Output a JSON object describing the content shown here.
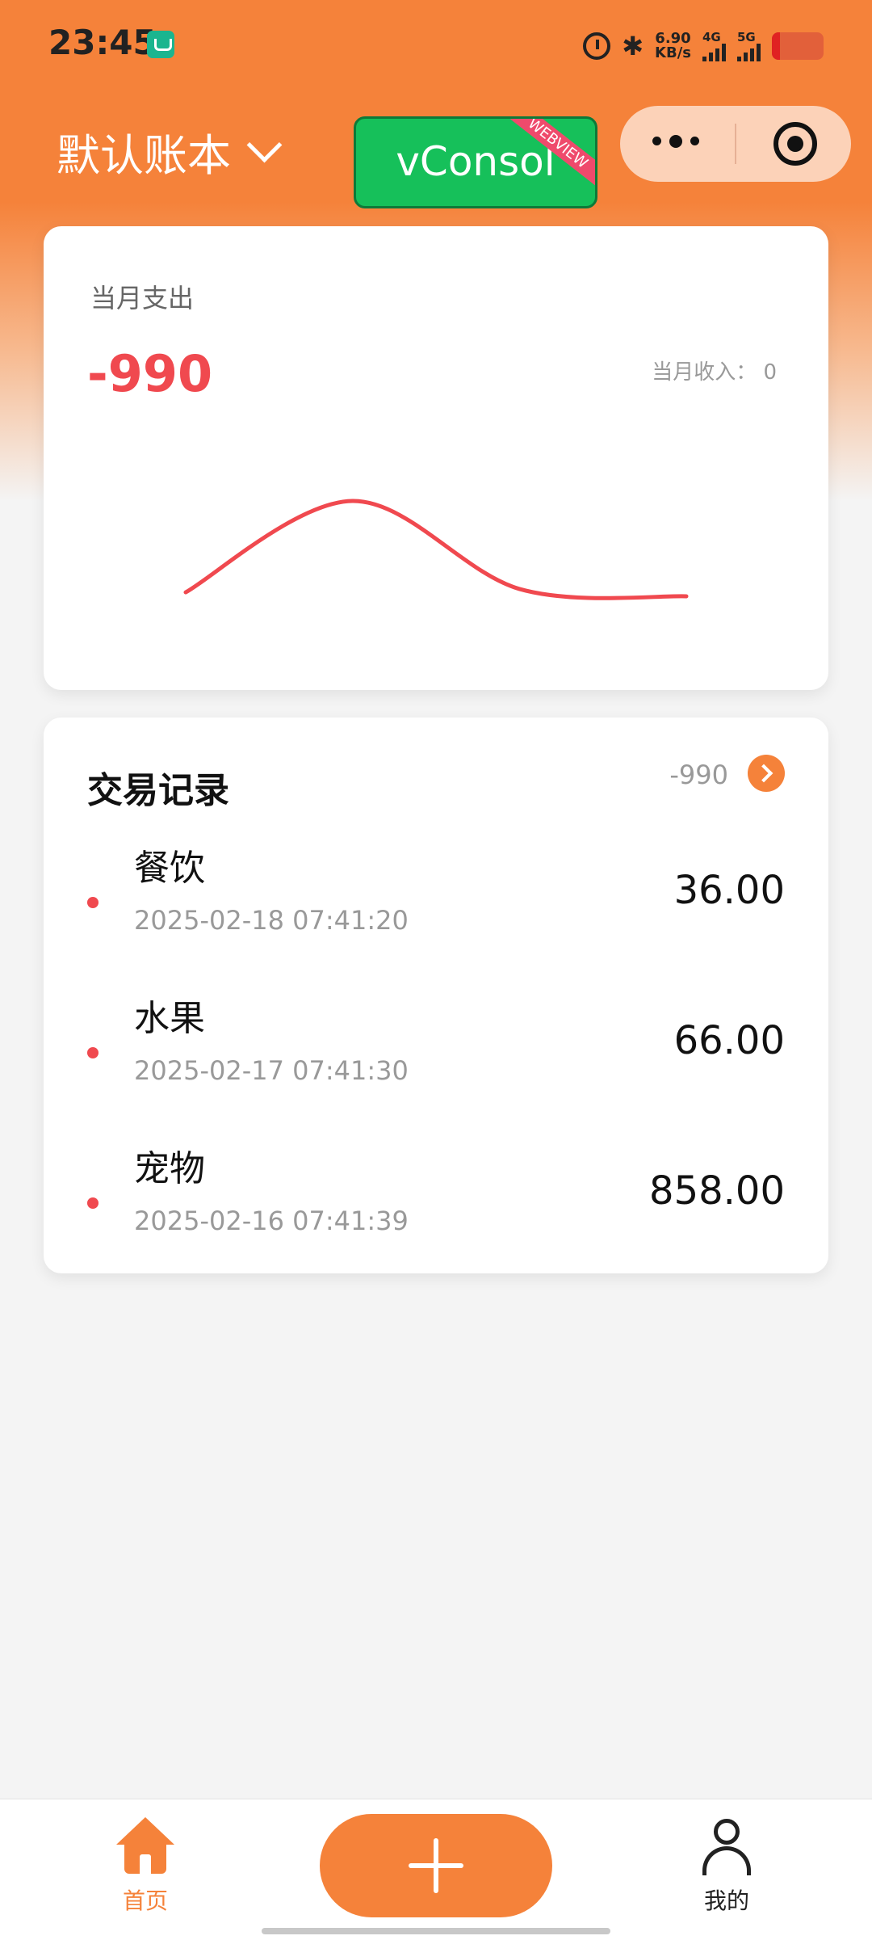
{
  "status_bar": {
    "time": "23:45",
    "net_speed_value": "6.90",
    "net_speed_unit": "KB/s",
    "sim1_label": "4G",
    "sim2_label": "5G",
    "battery_level": 0.15
  },
  "header": {
    "book_title": "默认账本",
    "vconsole_label": "vConsol",
    "webview_tag": "WEBVIEW"
  },
  "summary": {
    "expense_label": "当月支出",
    "expense_value": "-990",
    "income_text": "当月收入： 0",
    "trend_color": "#f0494f",
    "trend_values": [
      36,
      858,
      66,
      0
    ]
  },
  "records": {
    "title": "交易记录",
    "total": "-990",
    "items": [
      {
        "name": "餐饮",
        "time": "2025-02-18 07:41:20",
        "amount": "36.00"
      },
      {
        "name": "水果",
        "time": "2025-02-17 07:41:30",
        "amount": "66.00"
      },
      {
        "name": "宠物",
        "time": "2025-02-16 07:41:39",
        "amount": "858.00"
      }
    ]
  },
  "tabbar": {
    "home_label": "首页",
    "mine_label": "我的"
  },
  "colors": {
    "accent": "#f5823a",
    "expense": "#f0494f",
    "vconsole": "#16c05a"
  }
}
